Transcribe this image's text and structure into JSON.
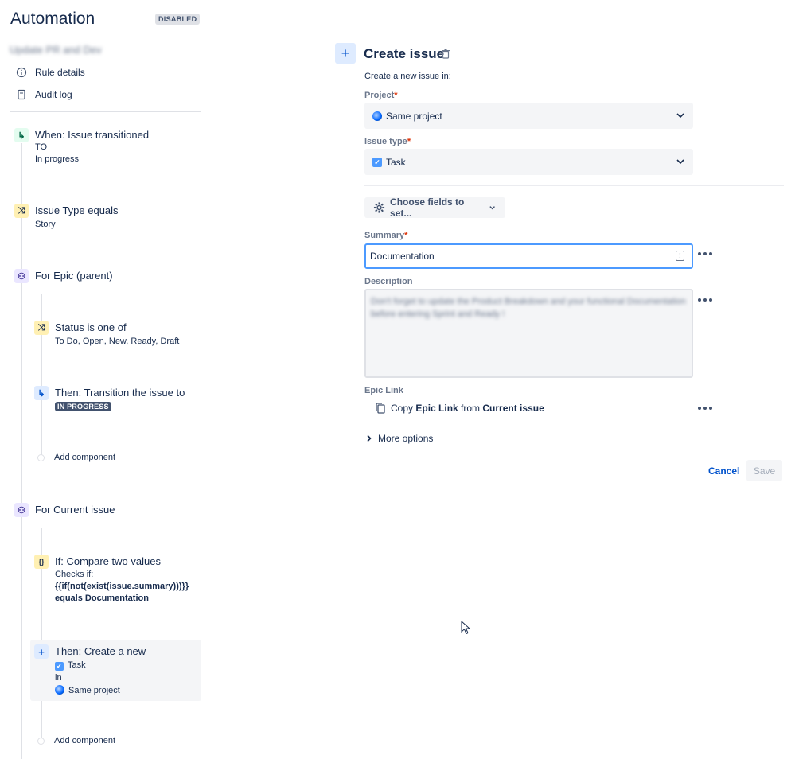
{
  "header": {
    "title": "Automation",
    "status": "DISABLED",
    "rule_name": "Update PR and Dev"
  },
  "nav": {
    "items": [
      {
        "label": "Rule details",
        "icon": "info-icon"
      },
      {
        "label": "Audit log",
        "icon": "document-icon"
      }
    ]
  },
  "rule": {
    "trigger": {
      "title": "When: Issue transitioned",
      "to_label": "TO",
      "to_value": "In progress"
    },
    "cond1": {
      "title": "Issue Type equals",
      "value": "Story"
    },
    "branch1": {
      "title": "For Epic (parent)",
      "cond": {
        "title": "Status is one of",
        "value": "To Do, Open, New, Ready, Draft"
      },
      "action": {
        "title": "Then: Transition the issue to",
        "status": "IN PROGRESS"
      },
      "add": "Add component"
    },
    "branch2": {
      "title": "For Current issue",
      "cond": {
        "title": "If: Compare two values",
        "checks": "Checks if:",
        "expr": "{{if(not(exist(issue.summary)))}}",
        "equals": "equals Documentation"
      },
      "action": {
        "title": "Then: Create a new",
        "type": "Task",
        "in": "in",
        "project": "Same project"
      },
      "add": "Add component"
    }
  },
  "panel": {
    "title": "Create issue",
    "intro": "Create a new issue in:",
    "project_label": "Project",
    "project_value": "Same project",
    "type_label": "Issue type",
    "type_value": "Task",
    "choose_fields": "Choose fields to set...",
    "summary_label": "Summary",
    "summary_value": "Documentation",
    "description_label": "Description",
    "description_value": "Don't forget to update the Product Breakdown and your functional Documentation before entering Sprint and Ready !",
    "epic_label": "Epic Link",
    "epic_copy": "Copy",
    "epic_field": "Epic Link",
    "epic_from": "from",
    "epic_source": "Current issue",
    "more_options": "More options",
    "cancel": "Cancel",
    "save": "Save",
    "required_mark": "*"
  },
  "colors": {
    "accent": "#0052cc",
    "focus": "#4c9aff",
    "required": "#de350b",
    "field_bg": "#f4f5f7"
  }
}
